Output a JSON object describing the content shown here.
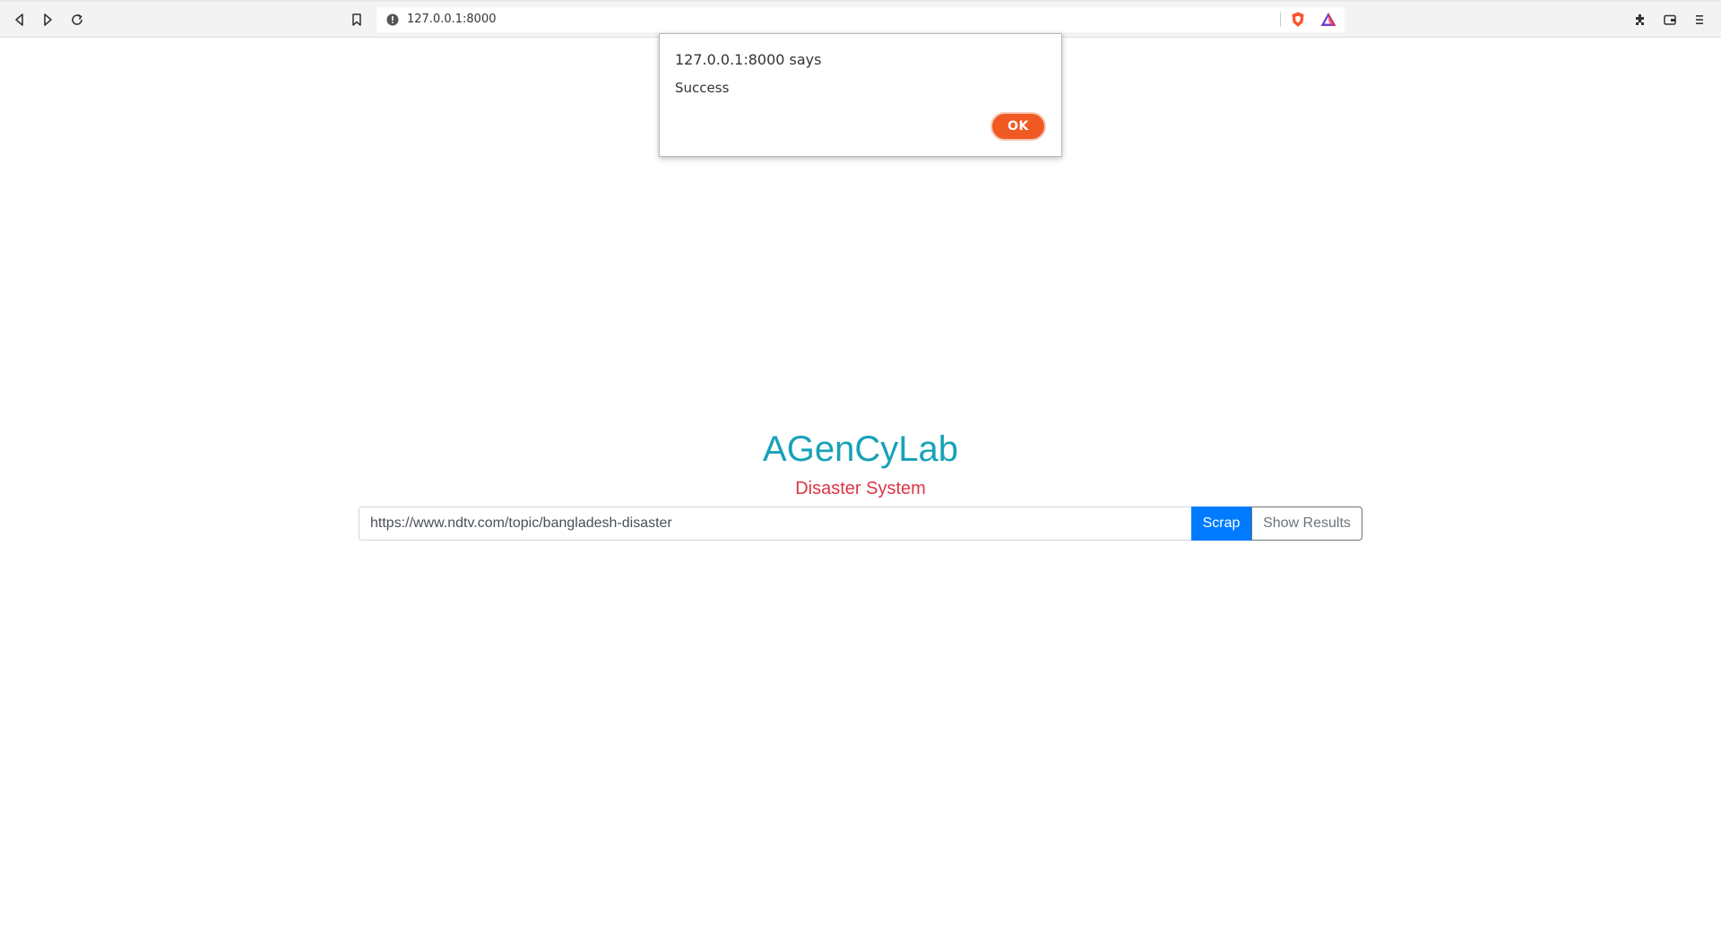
{
  "browser": {
    "address": "127.0.0.1:8000"
  },
  "dialog": {
    "title": "127.0.0.1:8000 says",
    "message": "Success",
    "ok_label": "OK"
  },
  "page": {
    "brand": "AGenCyLab",
    "subtitle": "Disaster System",
    "url_value": "https://www.ndtv.com/topic/bangladesh-disaster",
    "scrap_label": "Scrap",
    "show_results_label": "Show Results"
  },
  "colors": {
    "brand": "#17a2b8",
    "subtitle": "#dc3545",
    "primary": "#007bff",
    "ok_button": "#f05a22"
  }
}
